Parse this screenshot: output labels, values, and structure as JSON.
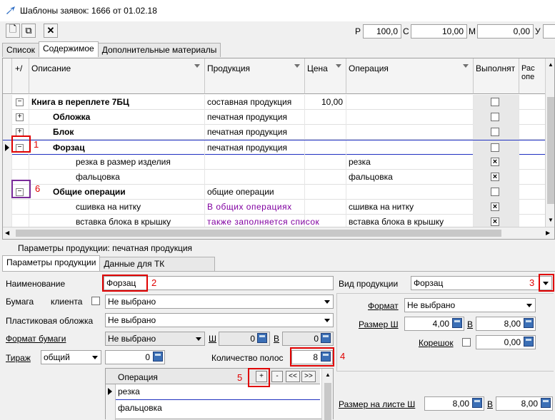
{
  "window": {
    "title": "Шаблоны заявок: 1666 от 01.02.18"
  },
  "toolbar": {
    "new_label": "🗋",
    "copy_label": "⧉",
    "delete_label": "✕",
    "fields": [
      {
        "label": "Р",
        "value": "100,0"
      },
      {
        "label": "С",
        "value": "10,00"
      },
      {
        "label": "М",
        "value": "0,00"
      },
      {
        "label": "У",
        "value": ""
      }
    ]
  },
  "tabs": [
    "Список",
    "Содержимое",
    "Дополнительные материалы"
  ],
  "grid": {
    "columns": [
      "+/",
      "Описание",
      "Продукция",
      "Цена",
      "Операция",
      "Выполнят",
      "Рас опе"
    ],
    "rows": [
      {
        "desc": "Книга в переплете 7БЦ",
        "prod": "составная продукция",
        "price": "10,00",
        "op": "",
        "checked": false,
        "bold": true,
        "level": 0,
        "exp": "−"
      },
      {
        "desc": "Обложка",
        "prod": "печатная продукция",
        "price": "",
        "op": "",
        "checked": false,
        "bold": true,
        "level": 1,
        "exp": "+"
      },
      {
        "desc": "Блок",
        "prod": "печатная продукция",
        "price": "",
        "op": "",
        "checked": false,
        "bold": true,
        "level": 1,
        "exp": "+"
      },
      {
        "desc": "Форзац",
        "prod": "печатная продукция",
        "price": "",
        "op": "",
        "checked": false,
        "bold": true,
        "level": 1,
        "exp": "−"
      },
      {
        "desc": "резка в размер изделия",
        "prod": "",
        "price": "",
        "op": "резка",
        "checked": true,
        "bold": false,
        "level": 2,
        "exp": ""
      },
      {
        "desc": "фальцовка",
        "prod": "",
        "price": "",
        "op": "фальцовка",
        "checked": true,
        "bold": false,
        "level": 2,
        "exp": ""
      },
      {
        "desc": "Общие операции",
        "prod": "общие операции",
        "price": "",
        "op": "",
        "checked": false,
        "bold": true,
        "level": 1,
        "exp": "−"
      },
      {
        "desc": "сшивка на нитку",
        "prod": "В общих операциях",
        "price": "",
        "op": "сшивка на нитку",
        "checked": true,
        "bold": false,
        "level": 2,
        "exp": ""
      },
      {
        "desc": "вставка блока в крышку",
        "prod": "также заполняется список",
        "price": "",
        "op": "вставка блока в крышку",
        "checked": true,
        "bold": false,
        "level": 2,
        "exp": ""
      }
    ]
  },
  "annotations": [
    "1",
    "2",
    "3",
    "4",
    "5",
    "6"
  ],
  "panel": {
    "title": "Параметры продукции: печатная продукция",
    "tabs": [
      "Параметры продукции",
      "Данные для ТК"
    ],
    "name_label": "Наименование",
    "name_value": "Форзац",
    "type_label": "Вид продукции",
    "type_value": "Форзац",
    "paper_label": "Бумага",
    "client_label": "клиента",
    "paper_value": "Не выбрано",
    "plastic_label": "Пластиковая обложка",
    "plastic_value": "Не выбрано",
    "format_paper_label": "Формат бумаги",
    "format_paper_value": "Не выбрано",
    "sh_label": "Ш",
    "sh_value": "0",
    "v_label": "В",
    "v_value": "0",
    "tirazh_label": "Тираж",
    "tirazh_type": "общий",
    "tirazh_value": "0",
    "pages_label": "Количество полос",
    "pages_value": "8",
    "ops_header": "Операция",
    "ops_buttons": [
      "+",
      "-",
      "<<",
      ">>"
    ],
    "ops_items": [
      "резка",
      "фальцовка"
    ],
    "format_label": "Формат",
    "format_value": "Не выбрано",
    "size_label": "Размер Ш",
    "size_w": "4,00",
    "size_v_label": "В",
    "size_h": "8,00",
    "spine_label": "Корешок",
    "spine_value": "0,00",
    "sheet_label": "Размер на листе Ш",
    "sheet_w": "8,00",
    "sheet_v_label": "В",
    "sheet_h": "8,00"
  }
}
